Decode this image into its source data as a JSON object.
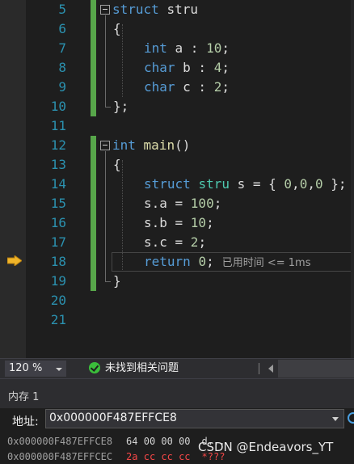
{
  "editor": {
    "line_numbers": [
      "5",
      "6",
      "7",
      "8",
      "9",
      "10",
      "11",
      "12",
      "13",
      "14",
      "15",
      "16",
      "17",
      "18",
      "19",
      "20",
      "21"
    ],
    "lines": {
      "l5": {
        "kw": "struct",
        "name": "stru"
      },
      "l6": {
        "text": "{"
      },
      "l7": {
        "kw": "int",
        "rest": " a : ",
        "num": "10",
        "end": ";"
      },
      "l8": {
        "kw": "char",
        "rest": " b : ",
        "num": "4",
        "end": ";"
      },
      "l9": {
        "kw": "char",
        "rest": " c : ",
        "num": "2",
        "end": ";"
      },
      "l10": {
        "text": "};"
      },
      "l12": {
        "kw": "int",
        "fn": "main",
        "end": "()"
      },
      "l13": {
        "text": "{"
      },
      "l14": {
        "kw": "struct",
        "ty": "stru",
        "rest": " s = { ",
        "n1": "0",
        "c1": ",",
        "n2": "0",
        "c2": ",",
        "n3": "0",
        "end": " };"
      },
      "l15": {
        "rest": "s.a = ",
        "num": "100",
        "end": ";"
      },
      "l16": {
        "rest": "s.b = ",
        "num": "10",
        "end": ";"
      },
      "l17": {
        "rest": "s.c = ",
        "num": "2",
        "end": ";"
      },
      "l18": {
        "kw": "return",
        "num": "0",
        "end": ";",
        "perf_tip": "已用时间 <= 1ms"
      },
      "l19": {
        "text": "}"
      }
    }
  },
  "status": {
    "zoom": "120 %",
    "issues": "未找到相关问题"
  },
  "memory": {
    "title": "内存 1",
    "address_label": "地址:",
    "address_value": "0x000000F487EFFCE8",
    "rows": [
      {
        "addr": "0x000000F487EFFCE8",
        "bytes": "64 00 00 00",
        "ascii": "d..."
      },
      {
        "addr": "0x000000F487EFFCEC",
        "bytes": "2a cc cc cc",
        "ascii": "*???"
      }
    ]
  },
  "watermark": "CSDN @Endeavors_YT",
  "colors": {
    "keyword": "#569cd6",
    "type": "#4ec9b0",
    "function": "#dcdcaa",
    "number": "#b5cea8",
    "line_number": "#2b91af",
    "change_bar": "#57a64a",
    "exec_arrow": "#f0b429",
    "changed_memory": "#f44747"
  },
  "icons": [
    "execution-arrow-icon",
    "fold-toggle-icon",
    "ok-check-icon",
    "dropdown-caret-icon",
    "refresh-icon"
  ]
}
